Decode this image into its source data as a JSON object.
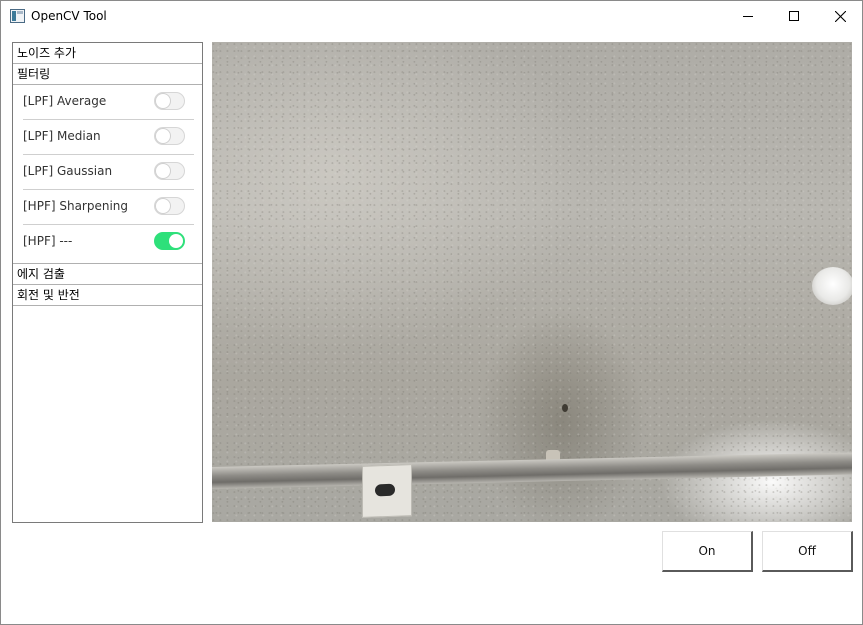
{
  "window": {
    "title": "OpenCV Tool",
    "icon": "app-window-icon",
    "controls": {
      "minimize": "minimize-icon",
      "maximize": "maximize-icon",
      "close": "close-icon"
    }
  },
  "panel": {
    "sections": [
      {
        "label": "노이즈 추가"
      },
      {
        "label": "필터링"
      },
      {
        "label": "에지 검출"
      },
      {
        "label": "회전 및 반전"
      }
    ],
    "filters": [
      {
        "label": "[LPF] Average",
        "on": false
      },
      {
        "label": "[LPF] Median",
        "on": false
      },
      {
        "label": "[LPF] Gaussian",
        "on": false
      },
      {
        "label": "[HPF] Sharpening",
        "on": false
      },
      {
        "label": "[HPF] ---",
        "on": true
      }
    ]
  },
  "actions": {
    "on_label": "On",
    "off_label": "Off"
  },
  "colors": {
    "toggle_on": "#2ee07a",
    "toggle_off": "#f2f2f2"
  }
}
